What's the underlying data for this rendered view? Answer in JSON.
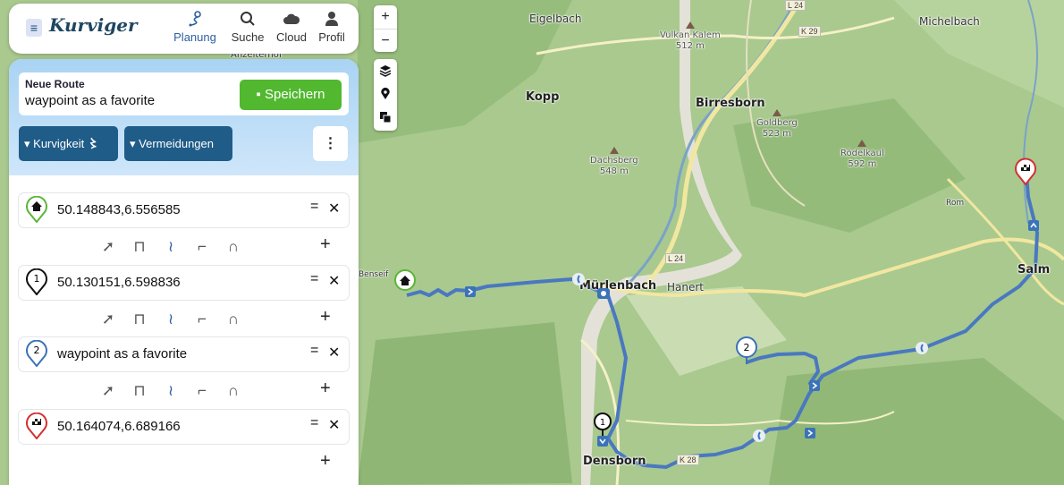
{
  "app": {
    "logo_text": "Kurviger",
    "nav": [
      {
        "label": "Planung",
        "icon": "route-planning-icon",
        "active": true
      },
      {
        "label": "Suche",
        "icon": "search-icon",
        "active": false
      },
      {
        "label": "Cloud",
        "icon": "cloud-icon",
        "active": false
      },
      {
        "label": "Profil",
        "icon": "user-icon",
        "active": false
      }
    ]
  },
  "route": {
    "caption": "Neue Route",
    "name": "waypoint as a favorite",
    "save_label": "Speichern",
    "curviness_label": "Kurvigkeit",
    "avoid_label": "Vermeidungen"
  },
  "waypoints": [
    {
      "marker": "home-icon",
      "marker_color": "#5cb537",
      "text": "50.148843,6.556585"
    },
    {
      "marker": "1",
      "marker_color": "#111111",
      "text": "50.130151,6.598836"
    },
    {
      "marker": "2",
      "marker_color": "#3b73b9",
      "text": "waypoint as a favorite"
    },
    {
      "marker": "finish-flag-icon",
      "marker_color": "#d33030",
      "text": "50.164074,6.689166"
    }
  ],
  "route_options": [
    "motorcycle-icon",
    "highway-icon",
    "curvy-road-icon",
    "winding-road-icon",
    "very-curvy-road-icon"
  ],
  "map": {
    "places": [
      {
        "name": "Eigelbach",
        "kind": "village"
      },
      {
        "name": "Michelbach",
        "kind": "village"
      },
      {
        "name": "Anzelterhof",
        "kind": "village"
      },
      {
        "name": "Kopp",
        "kind": "town"
      },
      {
        "name": "Birresborn",
        "kind": "town"
      },
      {
        "name": "Mürlenbach",
        "kind": "town"
      },
      {
        "name": "Hanert",
        "kind": "village"
      },
      {
        "name": "Densborn",
        "kind": "town"
      },
      {
        "name": "Salm",
        "kind": "town"
      },
      {
        "name": "Rom",
        "kind": "village"
      },
      {
        "name": "Benseif",
        "kind": "village"
      }
    ],
    "peaks": [
      {
        "name": "Vulkan Kalem",
        "elevation": "512 m"
      },
      {
        "name": "Dachsberg",
        "elevation": "548 m"
      },
      {
        "name": "Goldberg",
        "elevation": "523 m"
      },
      {
        "name": "Rödelkaul",
        "elevation": "592 m"
      }
    ],
    "roads": [
      "L 24",
      "K 29",
      "L 24",
      "K 28"
    ],
    "route_color": "#4a78c0"
  }
}
